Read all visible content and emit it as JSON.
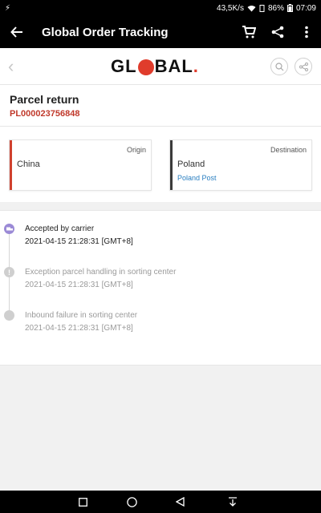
{
  "statusbar": {
    "left_icon": "usb-debug-icon",
    "speed": "43,5K/s",
    "battery": "86%",
    "time": "07:09"
  },
  "appbar": {
    "title": "Global Order Tracking",
    "icons": [
      "back-arrow-icon",
      "cart-icon",
      "share-icon",
      "more-vert-icon"
    ]
  },
  "site": {
    "logo_text": "GLOBAL"
  },
  "parcel": {
    "title": "Parcel return",
    "number": "PL000023756848"
  },
  "route": {
    "origin": {
      "label": "Origin",
      "country": "China",
      "color": "#d0412e"
    },
    "destination": {
      "label": "Destination",
      "country": "Poland",
      "carrier": "Poland Post",
      "color": "#3b3b3b"
    }
  },
  "events": [
    {
      "title": "Accepted by carrier",
      "time": "2021-04-15 21:28:31 [GMT+8]",
      "active": true,
      "icon": "truck-icon"
    },
    {
      "title": "Exception parcel handling in sorting center",
      "time": "2021-04-15 21:28:31 [GMT+8]",
      "active": false,
      "icon": "exclamation-icon"
    },
    {
      "title": "Inbound failure in sorting center",
      "time": "2021-04-15 21:28:31 [GMT+8]",
      "active": false,
      "icon": "dot-icon"
    }
  ],
  "colors": {
    "accent": "#c0392b",
    "active_dot": "#9b8ad6",
    "inactive_dot": "#cfcfcf",
    "link": "#2a7fc1"
  }
}
